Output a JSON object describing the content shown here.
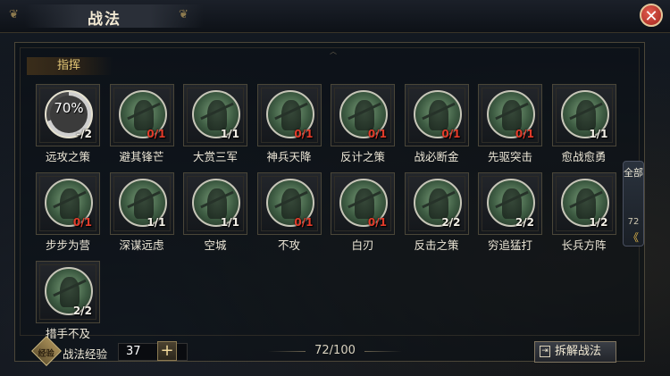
{
  "window": {
    "title": "战法",
    "close_icon": "close-icon"
  },
  "section": {
    "label": "指挥"
  },
  "skills": [
    {
      "name": "远攻之策",
      "count": "-/2",
      "progress": "70%",
      "count_color": "white"
    },
    {
      "name": "避其锋芒",
      "count": "0/1",
      "count_color": "red"
    },
    {
      "name": "大赏三军",
      "count": "1/1",
      "count_color": "white"
    },
    {
      "name": "神兵天降",
      "count": "0/1",
      "count_color": "red"
    },
    {
      "name": "反计之策",
      "count": "0/1",
      "count_color": "red"
    },
    {
      "name": "战必断金",
      "count": "0/1",
      "count_color": "red"
    },
    {
      "name": "先驱突击",
      "count": "0/1",
      "count_color": "red"
    },
    {
      "name": "愈战愈勇",
      "count": "1/1",
      "count_color": "white"
    },
    {
      "name": "步步为营",
      "count": "0/1",
      "count_color": "red"
    },
    {
      "name": "深谋远虑",
      "count": "1/1",
      "count_color": "white"
    },
    {
      "name": "空城",
      "count": "1/1",
      "count_color": "white"
    },
    {
      "name": "不攻",
      "count": "0/1",
      "count_color": "red"
    },
    {
      "name": "白刃",
      "count": "0/1",
      "count_color": "red"
    },
    {
      "name": "反击之策",
      "count": "2/2",
      "count_color": "white"
    },
    {
      "name": "穷追猛打",
      "count": "2/2",
      "count_color": "white"
    },
    {
      "name": "长兵方阵",
      "count": "1/2",
      "count_color": "white"
    },
    {
      "name": "措手不及",
      "count": "2/2",
      "count_color": "white"
    }
  ],
  "side_tab": {
    "label": "全部",
    "count": "72",
    "arrow": "《"
  },
  "footer": {
    "exp_label": "战法经验",
    "exp_value": "37",
    "exp_icon_text": "经验",
    "plus_label": "+",
    "capacity": "72/100",
    "decompose_label": "拆解战法"
  },
  "colors": {
    "red_count": "#e23b2a",
    "accent_gold": "#e6c978"
  }
}
